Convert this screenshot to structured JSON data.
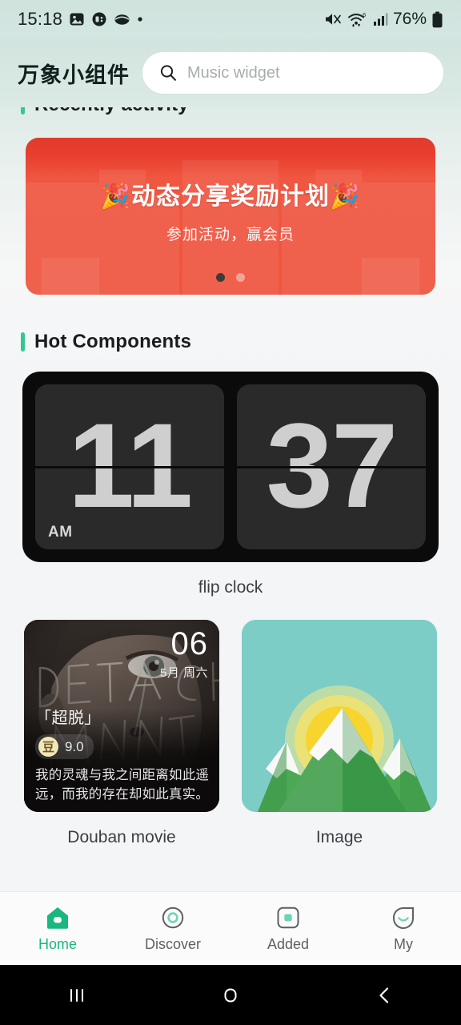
{
  "status_bar": {
    "time": "15:18",
    "battery_percent": "76%",
    "left_icons": [
      "gallery-icon",
      "app-circle-icon",
      "leaf-icon",
      "dot-icon"
    ],
    "right_icons": [
      "mute-icon",
      "wifi6-icon",
      "signal-icon",
      "battery-icon"
    ]
  },
  "header": {
    "app_title": "万象小组件",
    "search": {
      "placeholder": "Music widget",
      "value": ""
    }
  },
  "sections": {
    "recent": {
      "title": "Recently activity"
    },
    "hot": {
      "title": "Hot Components"
    }
  },
  "banner": {
    "title": "🎉动态分享奖励计划🎉",
    "subtitle": "参加活动，赢会员",
    "dots_total": 2,
    "dots_active_index": 0
  },
  "widgets": {
    "flip_clock": {
      "label": "flip clock",
      "hour": "11",
      "minute": "37",
      "meridiem": "AM"
    },
    "douban": {
      "label": "Douban movie",
      "day": "06",
      "month_weekday": "5月 周六",
      "movie_title": "「超脱」",
      "rating_badge": "豆",
      "rating": "9.0",
      "quote": "我的灵魂与我之间距离如此遥远，而我的存在却如此真实。",
      "poster_text": "DETACHMENT"
    },
    "image": {
      "label": "Image"
    }
  },
  "tabbar": {
    "items": [
      {
        "label": "Home",
        "icon": "home-icon",
        "active": true
      },
      {
        "label": "Discover",
        "icon": "compass-icon",
        "active": false
      },
      {
        "label": "Added",
        "icon": "square-icon",
        "active": false
      },
      {
        "label": "My",
        "icon": "profile-icon",
        "active": false
      }
    ]
  },
  "android_nav": {
    "recents": "recents-icon",
    "home": "home-nav-icon",
    "back": "back-icon"
  },
  "colors": {
    "accent_green": "#33c792",
    "tab_active": "#19b77f",
    "banner_red": "#ee5640",
    "header_mint": "#d4e5e0"
  }
}
